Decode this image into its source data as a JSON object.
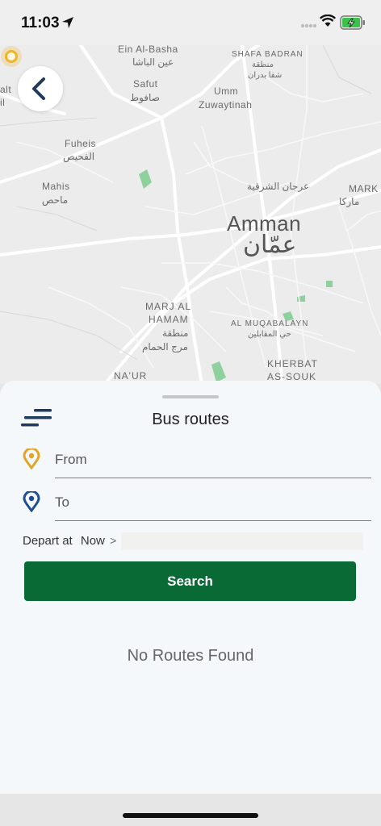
{
  "status_bar": {
    "time": "11:03"
  },
  "map": {
    "labels": {
      "ein_al_basha": "Ein Al-Basha",
      "ein_al_basha_ar": "عين الباشا",
      "shafa_badran": "SHAFA BADRAN",
      "shafa_badran_ar1": "منطقة",
      "shafa_badran_ar2": "شفا بدران",
      "salt": "alt",
      "salt2": "il",
      "safut": "Safut",
      "safut_ar": "صافوط",
      "umm": "Umm",
      "zuwaytinah": "Zuwaytinah",
      "fuheis": "Fuheis",
      "fuheis_ar": "الفحيص",
      "mahis": "Mahis",
      "mahis_ar": "ماحص",
      "arjan": "عرجان الشرقية",
      "marka": "MARK",
      "marka_ar": "ماركا",
      "amman": "Amman",
      "amman_ar": "عمّان",
      "marj_al_hamam_1": "MARJ AL",
      "marj_al_hamam_2": "HAMAM",
      "marj_ar1": "منطقة",
      "marj_ar2": "مرج الحمام",
      "al_muqabalayn": "AL MUQABALAYN",
      "al_muqabalayn_ar": "حي المقابلين",
      "naur": "NA'UR",
      "kherbat_1": "KHERBAT",
      "kherbat_2": "AS-SOUK"
    },
    "colors": {
      "background": "#ececec",
      "roads": "#ffffff",
      "parks": "#8fd19e",
      "location": "#f0b429"
    }
  },
  "sheet": {
    "title": "Bus routes",
    "from_label": "From",
    "to_label": "To",
    "depart_label": "Depart at",
    "depart_value": "Now",
    "chevron": ">",
    "search_label": "Search",
    "empty_message": "No Routes Found"
  },
  "icons": {
    "back": "chevron-left-icon",
    "menu": "filter-lines-icon",
    "from_pin": "map-pin-icon",
    "to_pin": "map-pin-icon"
  },
  "colors": {
    "accent": "#0a6a35",
    "from_pin": "#e0a526",
    "to_pin": "#1d4f8c"
  }
}
